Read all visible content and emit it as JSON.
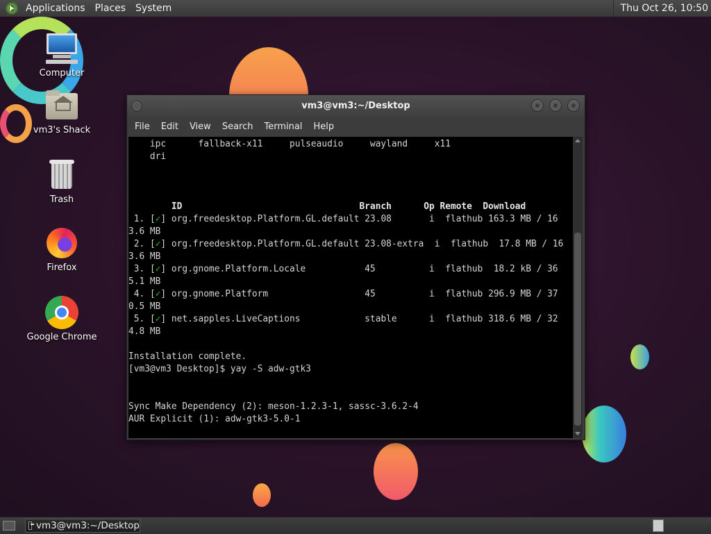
{
  "top_panel": {
    "menus": [
      "Applications",
      "Places",
      "System"
    ],
    "clock": "Thu Oct 26, 10:50"
  },
  "desktop_icons": [
    {
      "label": "Computer",
      "icon": "computer-icon"
    },
    {
      "label": "vm3's Shack",
      "icon": "home-folder-icon"
    },
    {
      "label": "Trash",
      "icon": "trash-icon"
    },
    {
      "label": "Firefox",
      "icon": "firefox-icon"
    },
    {
      "label": "Google Chrome",
      "icon": "chrome-icon"
    }
  ],
  "window": {
    "title": "vm3@vm3:~/Desktop",
    "menu": [
      "File",
      "Edit",
      "View",
      "Search",
      "Terminal",
      "Help"
    ]
  },
  "terminal": {
    "top_lines": [
      "    ipc      fallback-x11     pulseaudio     wayland     x11",
      "    dri"
    ],
    "header": "        ID                                 Branch      Op Remote  Download",
    "rows": [
      {
        "num": " 1. ",
        "pre": "[",
        "check": "✓",
        "post": "] org.freedesktop.Platform.GL.default 23.08       i  flathub 163.3 MB / 16",
        "wrap": "3.6 MB"
      },
      {
        "num": " 2. ",
        "pre": "[",
        "check": "✓",
        "post": "] org.freedesktop.Platform.GL.default 23.08-extra  i  flathub  17.8 MB / 16",
        "wrap": "3.6 MB"
      },
      {
        "num": " 3. ",
        "pre": "[",
        "check": "✓",
        "post": "] org.gnome.Platform.Locale           45          i  flathub  18.2 kB / 36",
        "wrap": "5.1 MB"
      },
      {
        "num": " 4. ",
        "pre": "[",
        "check": "✓",
        "post": "] org.gnome.Platform                  45          i  flathub 296.9 MB / 37",
        "wrap": "0.5 MB"
      },
      {
        "num": " 5. ",
        "pre": "[",
        "check": "✓",
        "post": "] net.sapples.LiveCaptions            stable      i  flathub 318.6 MB / 32",
        "wrap": "4.8 MB"
      }
    ],
    "complete": "Installation complete.",
    "prompt": "[vm3@vm3 Desktop]$ yay -S adw-gtk3",
    "sync": "Sync Make Dependency (2): meson-1.2.3-1, sassc-3.6.2-4",
    "aur": "AUR Explicit (1): adw-gtk3-5.0-1"
  },
  "taskbar": {
    "item_label": "vm3@vm3:~/Desktop"
  }
}
